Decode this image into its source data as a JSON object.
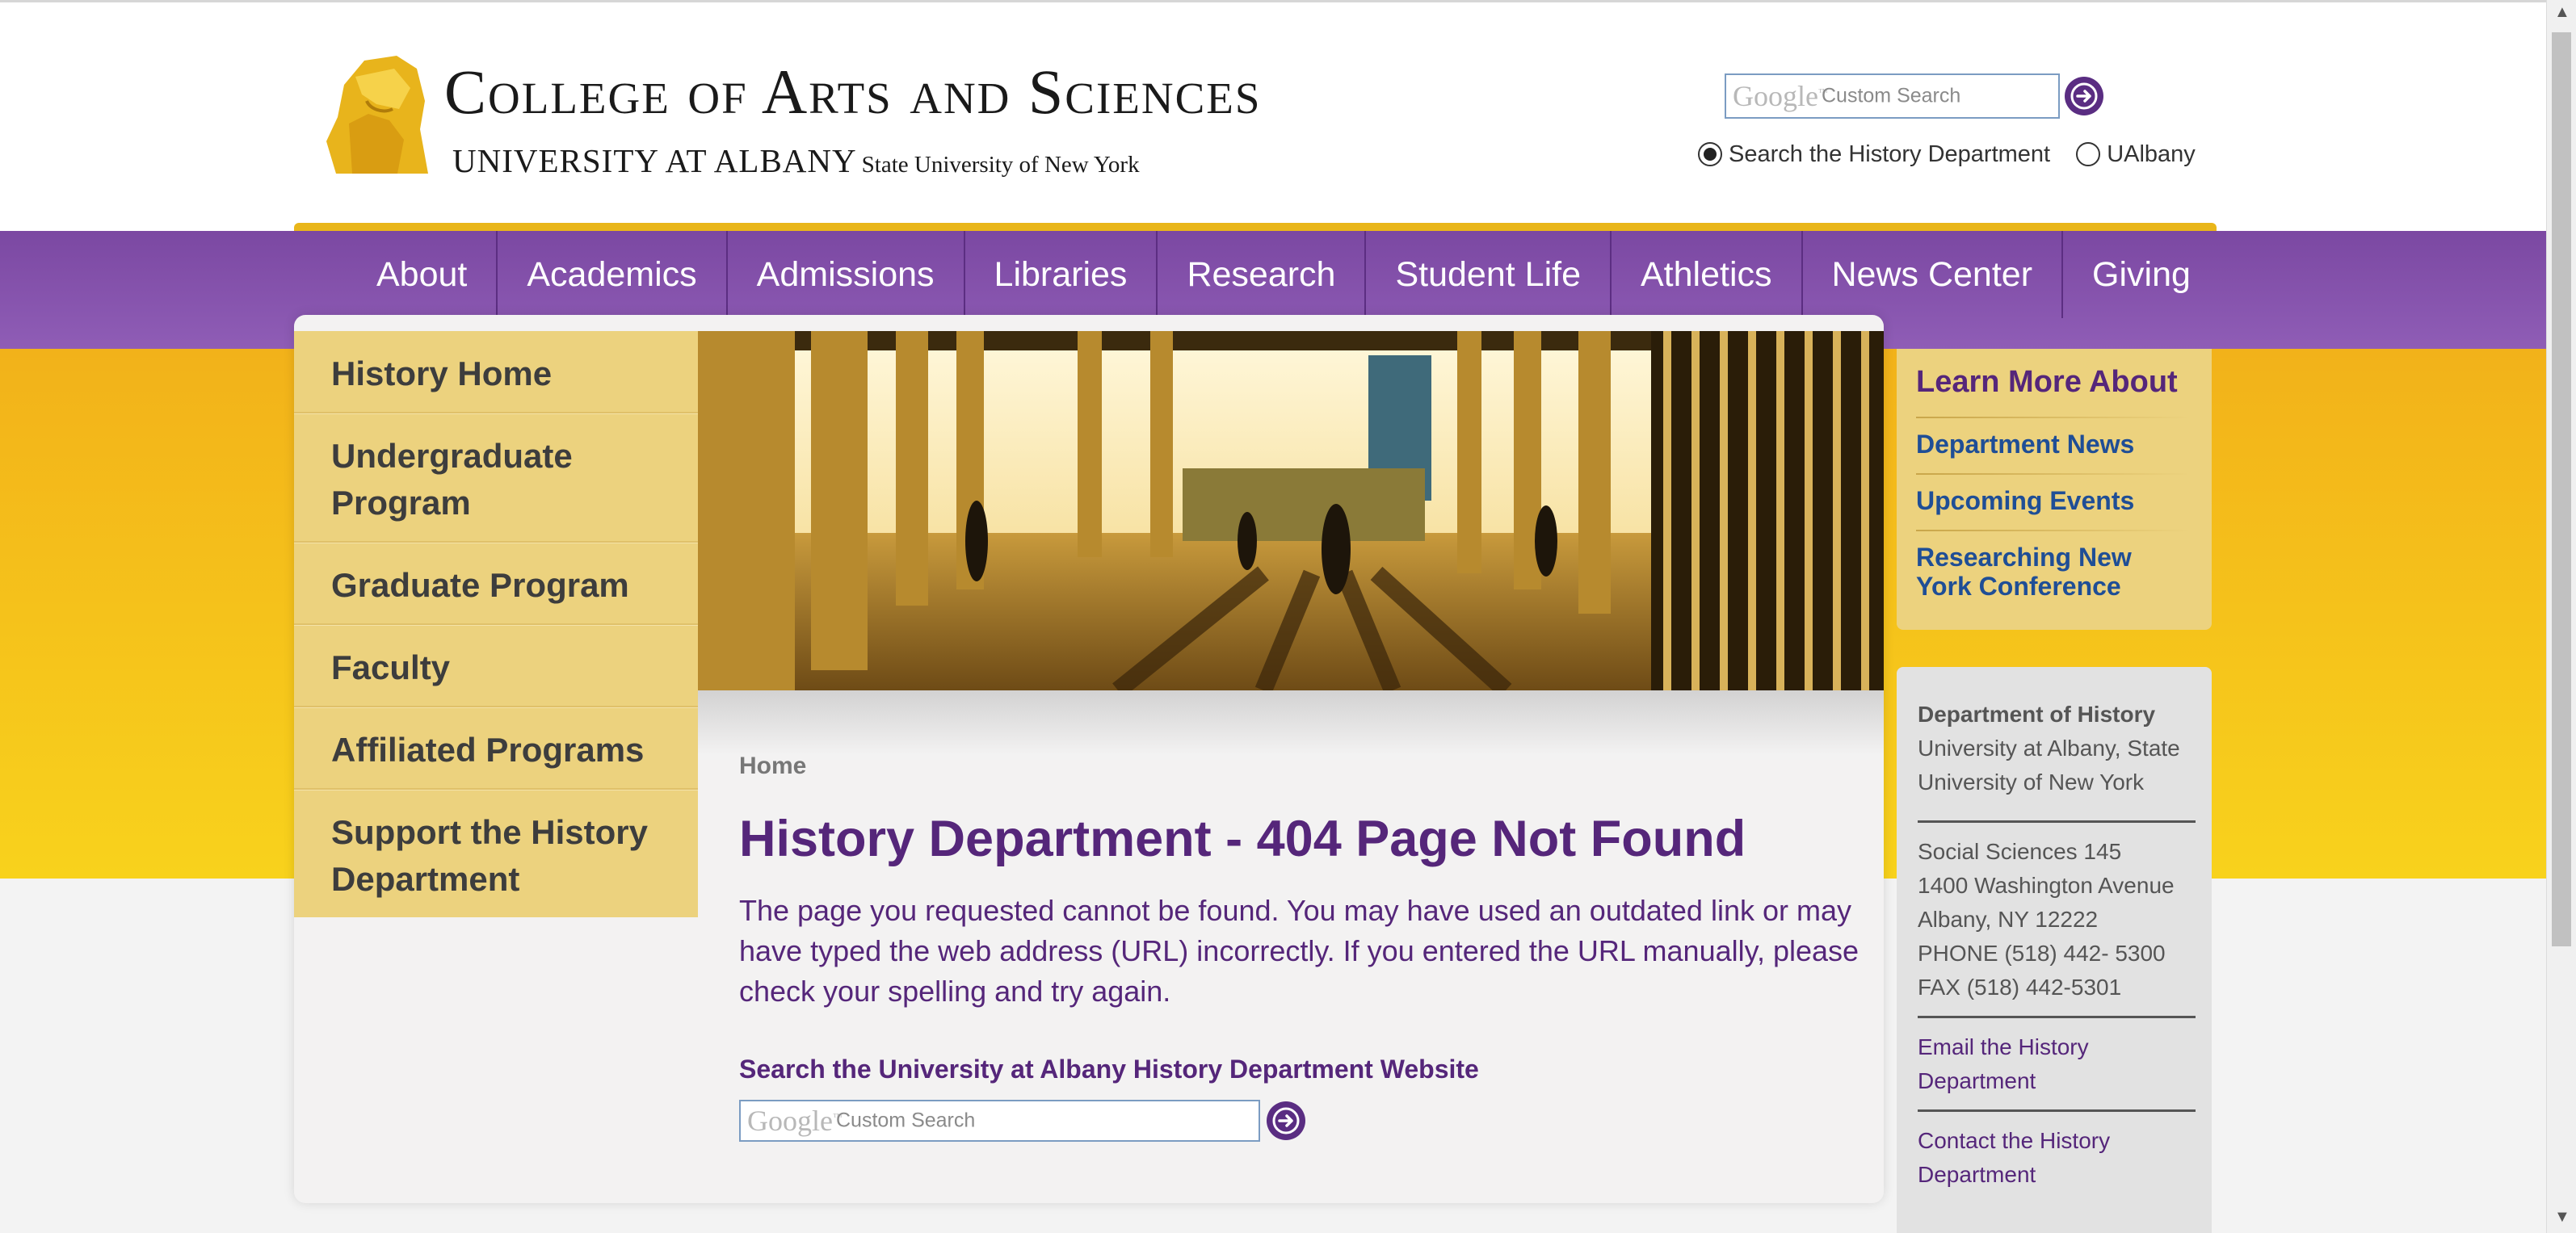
{
  "header": {
    "logo_title": "College of Arts and Sciences",
    "logo_subtitle_main": "UNIVERSITY AT ALBANY",
    "logo_subtitle_suny": "State University of New York",
    "search": {
      "brand": "Google",
      "placeholder": "Custom Search",
      "go_icon": "arrow-right-circle-icon"
    },
    "scope_options": [
      {
        "label": "Search the History Department",
        "selected": true
      },
      {
        "label": "UAlbany",
        "selected": false
      }
    ]
  },
  "nav": {
    "items": [
      "About",
      "Academics",
      "Admissions",
      "Libraries",
      "Research",
      "Student Life",
      "Athletics",
      "News Center",
      "Giving"
    ]
  },
  "left_nav": {
    "items": [
      "History Home",
      "Undergraduate Program",
      "Graduate Program",
      "Faculty",
      "Affiliated Programs",
      "Support the History Department"
    ]
  },
  "main": {
    "breadcrumb": "Home",
    "title": "History Department - 404 Page Not Found",
    "body": "The page you requested cannot be found. You may have used an outdated link or may have typed the web address (URL) incorrectly. If you entered the URL manually, please check your spelling and try again.",
    "search_heading": "Search the University at Albany History Department Website",
    "search": {
      "brand": "Google",
      "placeholder": "Custom Search"
    }
  },
  "learn_more": {
    "title": "Learn More About",
    "links": [
      "Department News",
      "Upcoming Events",
      "Researching New York Conference"
    ]
  },
  "contact": {
    "dept_name": "Department of History",
    "institution": "University at Albany, State University of New York",
    "address_lines": [
      "Social Sciences 145",
      "1400 Washington Avenue",
      "Albany, NY 12222",
      "PHONE (518) 442- 5300",
      "FAX (518) 442-5301"
    ],
    "email_link": "Email the History Department",
    "contact_link": "Contact the History Department"
  },
  "colors": {
    "purple": "#55267a",
    "nav_purple": "#7b48a2",
    "gold": "#f2b21a",
    "link_blue": "#1f4e96"
  }
}
